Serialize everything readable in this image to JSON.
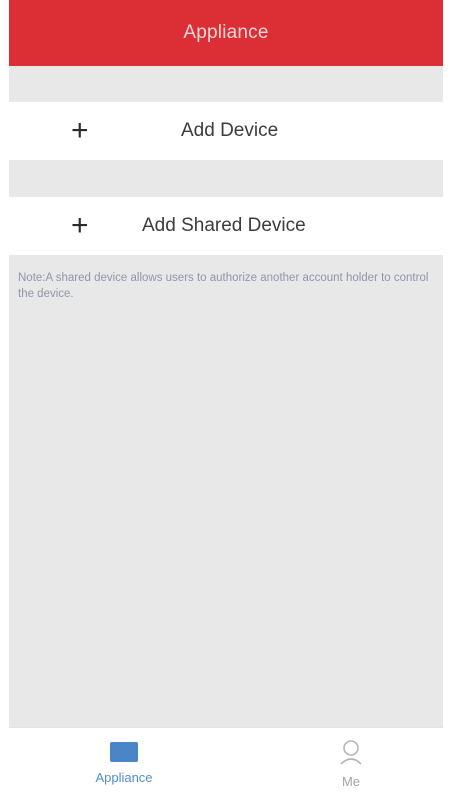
{
  "header": {
    "title": "Appliance"
  },
  "actions": {
    "add_device_label": "Add Device",
    "add_shared_device_label": "Add Shared Device",
    "plus_glyph": "+"
  },
  "note": {
    "text": "Note:A shared device allows users to authorize another account holder to control the device."
  },
  "tabs": [
    {
      "label": "Appliance",
      "icon": "appliance-icon",
      "active": true
    },
    {
      "label": "Me",
      "icon": "user-icon",
      "active": false
    }
  ],
  "colors": {
    "header_bg": "#dc2f35",
    "accent": "#4f8fd0",
    "inactive_tab": "#a4a4a4",
    "page_bg": "#e8e8e8"
  }
}
